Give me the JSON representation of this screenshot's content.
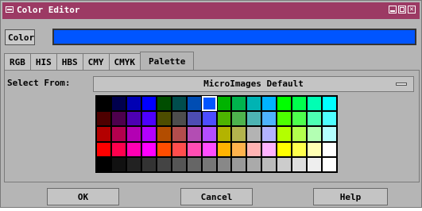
{
  "window": {
    "title": "Color Editor",
    "title_color": "#9c3a64"
  },
  "color_row": {
    "label": "Color",
    "current_color": "#0055ff"
  },
  "tabs": [
    {
      "label": "RGB",
      "active": false
    },
    {
      "label": "HIS",
      "active": false
    },
    {
      "label": "HBS",
      "active": false
    },
    {
      "label": "CMY",
      "active": false
    },
    {
      "label": "CMYK",
      "active": false
    },
    {
      "label": "Palette",
      "active": true
    }
  ],
  "palette": {
    "select_label": "Select From:",
    "selected_palette": "MicroImages Default",
    "selected_index": 7,
    "colors": [
      "#000000",
      "#00004d",
      "#0000b3",
      "#0000ff",
      "#004d00",
      "#004d4d",
      "#004db3",
      "#0055ff",
      "#00b300",
      "#00b34d",
      "#00b3b3",
      "#00b3ff",
      "#00ff00",
      "#00ff4d",
      "#00ffb3",
      "#00ffff",
      "#4d0000",
      "#4d004d",
      "#4d00b3",
      "#4d00ff",
      "#4d4d00",
      "#4d4d4d",
      "#4d4db3",
      "#4d4dff",
      "#4db300",
      "#4db34d",
      "#4db3b3",
      "#4db3ff",
      "#4dff00",
      "#4dff4d",
      "#4dffb3",
      "#4dffff",
      "#b30000",
      "#b3004d",
      "#b300b3",
      "#b300ff",
      "#b34d00",
      "#b34d4d",
      "#b34db3",
      "#b34dff",
      "#b3b300",
      "#b3b34d",
      "#b3b3b3",
      "#b3b3ff",
      "#b3ff00",
      "#b3ff4d",
      "#b3ffb3",
      "#b3ffff",
      "#ff0000",
      "#ff004d",
      "#ff00b3",
      "#ff00ff",
      "#ff4d00",
      "#ff4d4d",
      "#ff4db3",
      "#ff4dff",
      "#ffb300",
      "#ffb34d",
      "#ffb3b3",
      "#ffb3ff",
      "#ffff00",
      "#ffff4d",
      "#ffffb3",
      "#ffffff",
      "#000000",
      "#111111",
      "#222222",
      "#333333",
      "#444444",
      "#555555",
      "#666666",
      "#777777",
      "#888888",
      "#999999",
      "#aaaaaa",
      "#bbbbbb",
      "#cccccc",
      "#dddddd",
      "#eeeeee",
      "#ffffff"
    ]
  },
  "buttons": {
    "ok": "OK",
    "cancel": "Cancel",
    "help": "Help"
  }
}
